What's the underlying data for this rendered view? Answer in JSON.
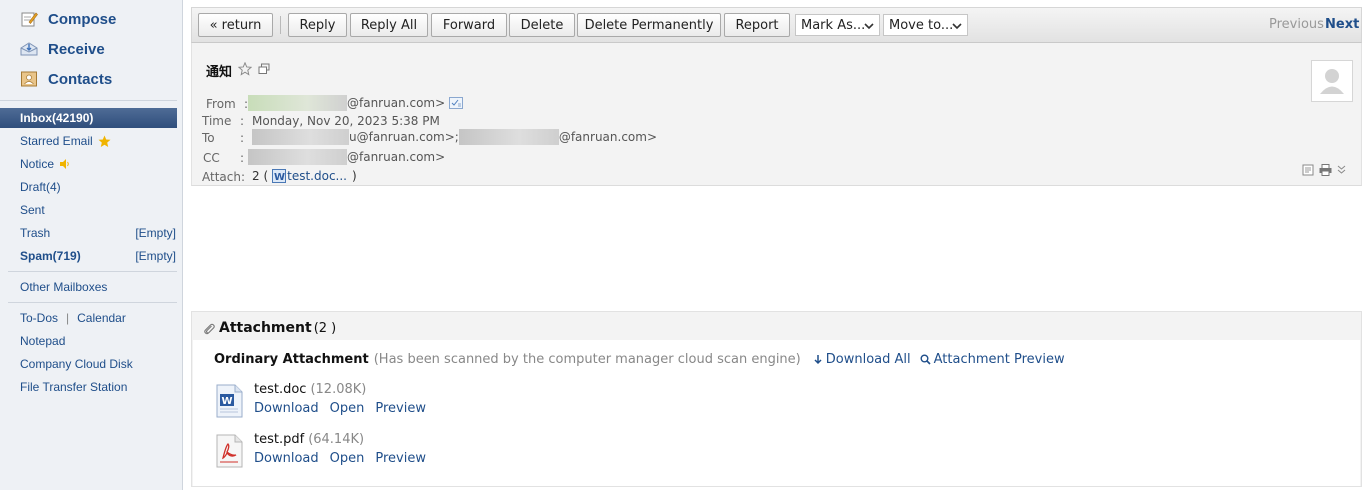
{
  "sidebar": {
    "compose": "Compose",
    "receive": "Receive",
    "contacts": "Contacts",
    "inbox": "Inbox(42190)",
    "starred": "Starred Email",
    "notice": "Notice",
    "draft": "Draft(4)",
    "sent": "Sent",
    "trash": "Trash",
    "trash_action": "[Empty]",
    "spam": "Spam(719)",
    "spam_action": "[Empty]",
    "other_mailboxes": "Other Mailboxes",
    "todos": "To-Dos",
    "pipe": "|",
    "calendar": "Calendar",
    "notepad": "Notepad",
    "cloud_disk": "Company Cloud Disk",
    "file_transfer": "File Transfer Station"
  },
  "toolbar": {
    "return": "« return",
    "reply": "Reply",
    "reply_all": "Reply All",
    "forward": "Forward",
    "delete": "Delete",
    "delete_permanently": "Delete Permanently",
    "report": "Report",
    "mark_as": "Mark As...",
    "move_to": "Move to...",
    "previous": "Previous",
    "next": "Next"
  },
  "email": {
    "subject": "通知",
    "from_label": "From",
    "from_value": "@fanruan.com>",
    "time_label": "Time",
    "time_value": "Monday, Nov 20, 2023 5:38 PM",
    "to_label": "To",
    "to_value_1": "u@fanruan.com>;",
    "to_value_2": "@fanruan.com>",
    "cc_label": "CC",
    "cc_value": "@fanruan.com>",
    "colon": ":",
    "attach_label": "Attach:",
    "attach_count": "2 (",
    "attach_file": "test.doc...",
    "attach_close": ")"
  },
  "attachments": {
    "title": "Attachment",
    "count": "(2 )",
    "ordinary": "Ordinary Attachment",
    "scan_note": "(Has been scanned by the computer manager cloud scan engine)",
    "download_all": "Download All",
    "preview_all": "Attachment Preview",
    "files": [
      {
        "name": "test.doc",
        "size": "(12.08K)",
        "download": "Download",
        "open": "Open",
        "preview": "Preview",
        "type": "word"
      },
      {
        "name": "test.pdf",
        "size": "(64.14K)",
        "download": "Download",
        "open": "Open",
        "preview": "Preview",
        "type": "pdf"
      }
    ]
  },
  "colors": {
    "link": "#1f4e8a",
    "active_nav": "#2f4e7c",
    "sidebar_bg": "#eef1f5",
    "star": "#f0b400"
  }
}
